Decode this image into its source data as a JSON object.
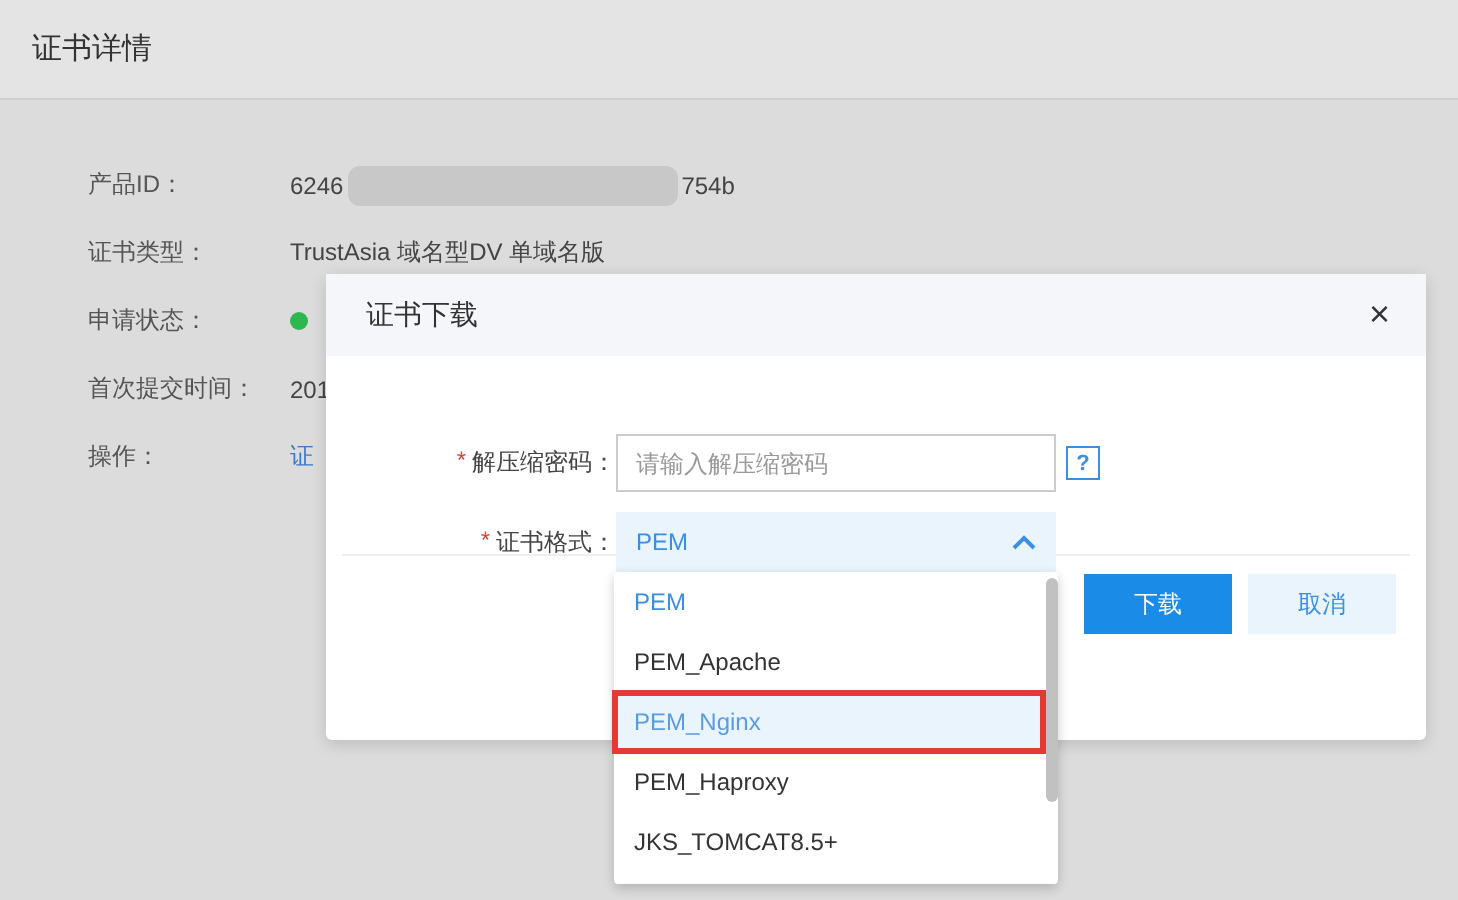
{
  "page": {
    "title": "证书详情"
  },
  "details": [
    {
      "kind": "redacted",
      "label": "产品ID：",
      "value_before": "6246",
      "value_after": "754b"
    },
    {
      "kind": "text",
      "label": "证书类型：",
      "value": "TrustAsia 域名型DV 单域名版"
    },
    {
      "kind": "status",
      "label": "申请状态：",
      "color": "#2db84d"
    },
    {
      "kind": "text",
      "label": "首次提交时间：",
      "value": "201"
    },
    {
      "kind": "link",
      "label": "操作：",
      "value": "证"
    }
  ],
  "dialog": {
    "title": "证书下载",
    "close": "×",
    "fields": [
      {
        "kind": "input",
        "required_mark": "*",
        "label": "解压缩密码：",
        "placeholder": "请输入解压缩密码",
        "help": "?"
      },
      {
        "kind": "select",
        "required_mark": "*",
        "label": "证书格式：",
        "value": "PEM",
        "expanded": true
      }
    ],
    "options": [
      {
        "label": "PEM",
        "selected": true,
        "hovered": false,
        "highlighted": false
      },
      {
        "label": "PEM_Apache",
        "selected": false,
        "hovered": false,
        "highlighted": false
      },
      {
        "label": "PEM_Nginx",
        "selected": false,
        "hovered": true,
        "highlighted": true
      },
      {
        "label": "PEM_Haproxy",
        "selected": false,
        "hovered": false,
        "highlighted": false
      },
      {
        "label": "JKS_TOMCAT8.5+",
        "selected": false,
        "hovered": false,
        "highlighted": false
      }
    ],
    "buttons": [
      {
        "label": "下载",
        "kind": "primary"
      },
      {
        "label": "取消",
        "kind": "secondary"
      }
    ]
  }
}
